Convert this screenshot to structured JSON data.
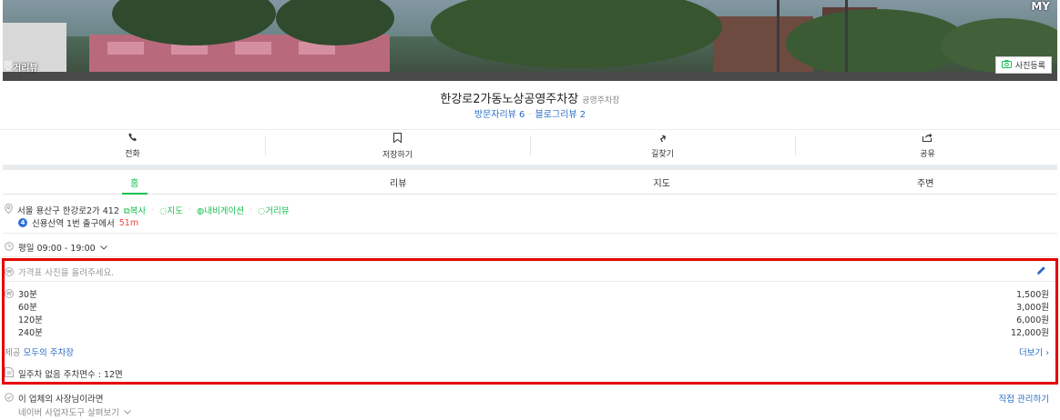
{
  "header": {
    "street_view_label": "거리뷰",
    "my_label": "MY",
    "add_photo_label": "사진등록"
  },
  "place": {
    "name": "한강로2가동노상공영주차장",
    "category": "공영주차장",
    "visitor_reviews": "방문자리뷰 6",
    "blog_reviews": "블로그리뷰 2"
  },
  "actions": [
    {
      "label": "전화",
      "icon": "phone-icon"
    },
    {
      "label": "저장하기",
      "icon": "bookmark-icon"
    },
    {
      "label": "길찾기",
      "icon": "directions-icon"
    },
    {
      "label": "공유",
      "icon": "share-icon"
    }
  ],
  "tabs": [
    "홈",
    "리뷰",
    "지도",
    "주변"
  ],
  "active_tab": "홈",
  "address": {
    "text": "서울 용산구 한강로2가 412",
    "copy": "복사",
    "map": "지도",
    "navigation": "내비게이션",
    "street_view": "거리뷰",
    "subway_line": "4",
    "subway_text": "신용산역 1번 출구에서",
    "subway_distance": "51m"
  },
  "hours": {
    "text": "평일 09:00 - 19:00"
  },
  "price_photo_prompt": "가격표 사진을 올려주세요.",
  "prices": [
    {
      "duration": "30분",
      "price": "1,500원"
    },
    {
      "duration": "60분",
      "price": "3,000원"
    },
    {
      "duration": "120분",
      "price": "6,000원"
    },
    {
      "duration": "240분",
      "price": "12,000원"
    }
  ],
  "provider": {
    "prefix": "제공",
    "name": "모두의 주차장"
  },
  "more_label": "더보기",
  "parking_info": "일주차 없음 주차면수 : 12면",
  "owner": {
    "prompt": "이 업체의 사장님이라면",
    "tool_link": "네이버 사업자도구 살펴보기",
    "manage_label": "직접 관리하기"
  },
  "colors": {
    "accent_green": "#19c153",
    "link_blue": "#2a6cc8",
    "highlight_red": "#e60000"
  }
}
